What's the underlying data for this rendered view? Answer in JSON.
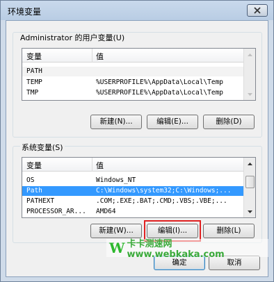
{
  "window": {
    "title": "环境变量"
  },
  "user_vars": {
    "label": "Administrator 的用户变量(U)",
    "columns": [
      "变量",
      "值"
    ],
    "rows": [
      {
        "name": "PATH",
        "value": ""
      },
      {
        "name": "TEMP",
        "value": "%USERPROFILE%\\AppData\\Local\\Temp"
      },
      {
        "name": "TMP",
        "value": "%USERPROFILE%\\AppData\\Local\\Temp"
      }
    ],
    "buttons": {
      "new": "新建(N)...",
      "edit": "编辑(E)...",
      "delete": "删除(D)"
    }
  },
  "system_vars": {
    "label": "系统变量(S)",
    "columns": [
      "变量",
      "值"
    ],
    "rows": [
      {
        "name": "OS",
        "value": "Windows_NT"
      },
      {
        "name": "Path",
        "value": "C:\\Windows\\system32;C:\\Windows;..."
      },
      {
        "name": "PATHEXT",
        "value": ".COM;.EXE;.BAT;.CMD;.VBS;.VBE;..."
      },
      {
        "name": "PROCESSOR_AR...",
        "value": "AMD64"
      }
    ],
    "selected_index": 1,
    "buttons": {
      "new": "新建(W)...",
      "edit": "编辑(I)...",
      "delete": "删除(L)"
    }
  },
  "dialog_buttons": {
    "ok": "确定",
    "cancel": "取消"
  },
  "watermark": {
    "letter": "W",
    "text": "卡卡测速网 www.webkaka.com"
  },
  "colors": {
    "selection": "#3399ff",
    "highlight": "#e02020",
    "watermark": "#2eb82e"
  }
}
